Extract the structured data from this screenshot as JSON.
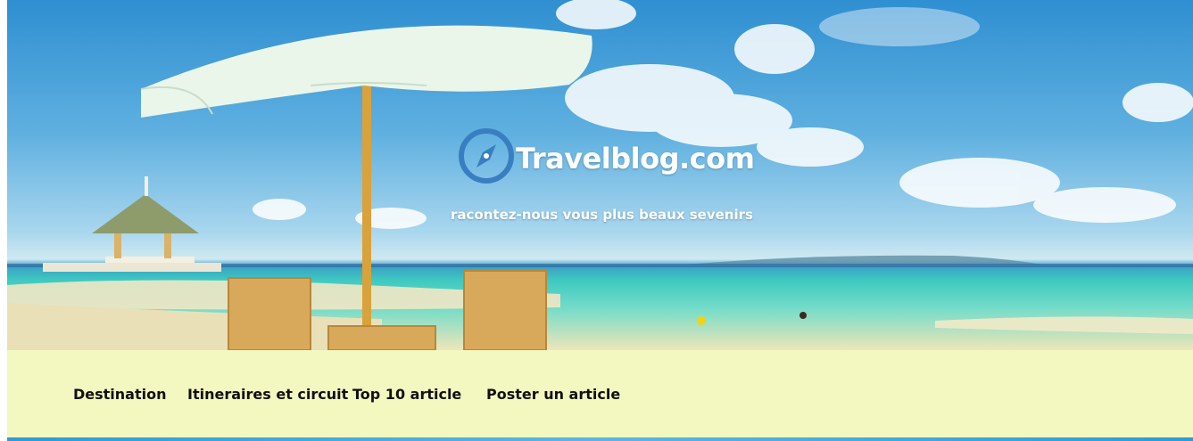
{
  "header": {
    "site_name": "Travelblog.com",
    "tagline": "racontez-nous vous plus beaux sevenirs",
    "logo_icon": "compass-icon",
    "colors": {
      "logo": "#3a7ec2",
      "nav_background": "#f3f7c0"
    }
  },
  "nav": {
    "items": [
      {
        "label": "Destination"
      },
      {
        "label": "Itineraires et circuit"
      },
      {
        "label": "Top 10 article"
      },
      {
        "label": "Poster un article"
      }
    ]
  }
}
